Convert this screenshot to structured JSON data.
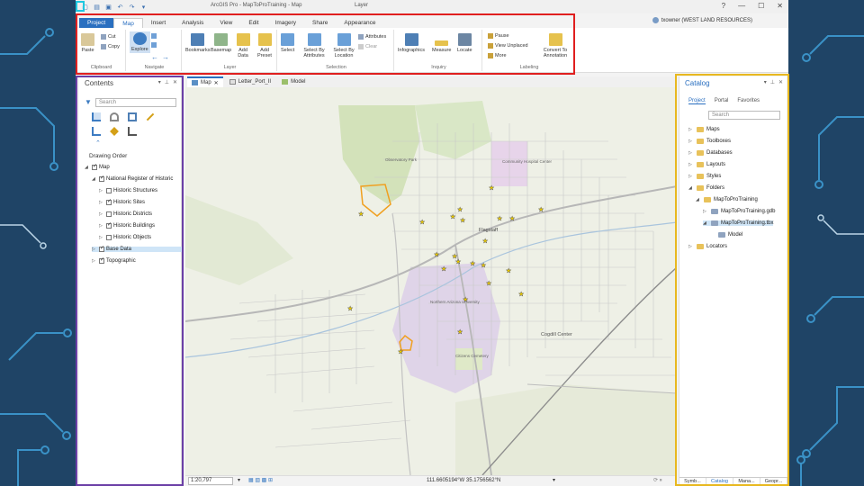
{
  "titlebar": {
    "app_title": "ArcGIS Pro - MapToProTraining - Map",
    "context_tab": "Layer",
    "help": "?",
    "minimize": "—",
    "maximize": "☐",
    "close": "✕"
  },
  "tabs": [
    "Project",
    "Map",
    "Insert",
    "Analysis",
    "View",
    "Edit",
    "Imagery",
    "Share",
    "Appearance"
  ],
  "user": "txowner (WEST LAND RESOURCES)",
  "ribbon": {
    "clipboard": {
      "paste": "Paste",
      "cut": "Cut",
      "copy": "Copy",
      "label": "Clipboard"
    },
    "navigate": {
      "explore": "Explore",
      "label": "Navigate"
    },
    "layer": {
      "bookmarks": "Bookmarks",
      "basemap": "Basemap",
      "add_data": "Add Data",
      "add_preset": "Add Preset",
      "label": "Layer"
    },
    "selection": {
      "select": "Select",
      "select_by_attributes": "Select By Attributes",
      "select_by_location": "Select By Location",
      "attributes": "Attributes",
      "clear": "Clear",
      "label": "Selection"
    },
    "inquiry": {
      "infographics": "Infographics",
      "measure": "Measure",
      "locate": "Locate",
      "label": "Inquiry"
    },
    "labeling": {
      "pause": "Pause",
      "view_unplaced": "View Unplaced",
      "more": "More",
      "convert": "Convert To Annotation",
      "label": "Labeling"
    }
  },
  "contents": {
    "title": "Contents",
    "search_placeholder": "Search",
    "drawing_order": "Drawing Order",
    "layers": [
      {
        "name": "Map",
        "checked": true,
        "level": 0
      },
      {
        "name": "National Register of Historic",
        "checked": true,
        "level": 1
      },
      {
        "name": "Historic Structures",
        "checked": false,
        "level": 2
      },
      {
        "name": "Historic Sites",
        "checked": true,
        "level": 2
      },
      {
        "name": "Historic Districts",
        "checked": false,
        "level": 2
      },
      {
        "name": "Historic Buildings",
        "checked": true,
        "level": 2
      },
      {
        "name": "Historic Objects",
        "checked": false,
        "level": 2
      },
      {
        "name": "Base Data",
        "checked": true,
        "level": 1,
        "selected": true
      },
      {
        "name": "Topographic",
        "checked": true,
        "level": 1
      }
    ]
  },
  "map_tabs": [
    "Map",
    "Letter_Port_II",
    "Model"
  ],
  "map_labels": {
    "mountain": "Observatory Park",
    "hospital": "Community Hospital Center",
    "center": "Flagstaff",
    "university": "Northern Arizona University",
    "cogdill": "Cogdill Center",
    "cemetery": "Citizens Cemetery"
  },
  "statusbar": {
    "scale": "1:20,797",
    "coords": "111.6605194°W 35.1756562°N"
  },
  "catalog": {
    "title": "Catalog",
    "tabs": [
      "Project",
      "Portal",
      "Favorites"
    ],
    "search_placeholder": "Search",
    "items": [
      {
        "name": "Maps",
        "level": 0
      },
      {
        "name": "Toolboxes",
        "level": 0
      },
      {
        "name": "Databases",
        "level": 0
      },
      {
        "name": "Layouts",
        "level": 0
      },
      {
        "name": "Styles",
        "level": 0
      },
      {
        "name": "Folders",
        "level": 0
      },
      {
        "name": "MapToProTraining",
        "level": 1
      },
      {
        "name": "MapToProTraining.gdb",
        "level": 2
      },
      {
        "name": "MapToProTraining.tbx",
        "level": 2,
        "selected": true
      },
      {
        "name": "Model",
        "level": 3
      },
      {
        "name": "Locators",
        "level": 0
      }
    ],
    "bottom_tabs": [
      "Symb...",
      "Catalog",
      "Mana...",
      "Geopr..."
    ]
  },
  "colors": {
    "accent": "#2a6fc0",
    "ribbon_highlight": "#e01f1f",
    "contents_highlight": "#6b3fa6",
    "catalog_highlight": "#e8b81f",
    "quick_access_highlight": "#1ec8e0"
  }
}
